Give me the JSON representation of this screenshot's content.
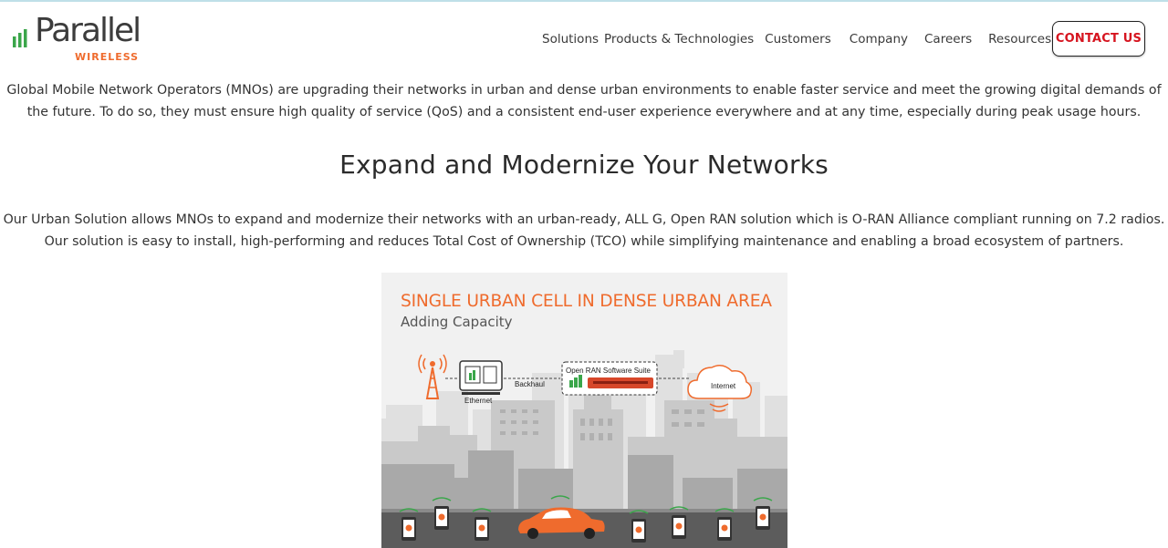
{
  "brand": {
    "name": "Parallel",
    "tagline": "WIRELESS",
    "accent_color": "#ef6b2d",
    "bars_color": "#3aa64a"
  },
  "nav": {
    "items": [
      {
        "label": "Solutions"
      },
      {
        "label": "Products & Technologies"
      },
      {
        "label": "Customers"
      },
      {
        "label": "Company"
      },
      {
        "label": "Careers"
      },
      {
        "label": "Resources"
      }
    ],
    "search_icon": "search-icon",
    "contact_label": "CONTACT US",
    "contact_color": "#d6141f"
  },
  "content": {
    "intro": "Global Mobile Network Operators (MNOs) are upgrading their networks in urban and dense urban environments to enable faster service and meet the growing digital demands of the future. To do so, they must ensure high quality of service (QoS) and a consistent end-user experience everywhere and at any time, especially during peak usage hours.",
    "heading": "Expand and Modernize Your Networks",
    "body": "Our Urban Solution allows MNOs to expand and modernize their networks with an urban-ready, ALL G, Open RAN solution which is O-RAN Alliance compliant running on 7.2 radios. Our solution is easy to install, high-performing and reduces Total Cost of Ownership (TCO) while simplifying maintenance and enabling a broad ecosystem of partners."
  },
  "infographic": {
    "title": "SINGLE URBAN CELL IN DENSE URBAN AREA",
    "subtitle": "Adding Capacity",
    "labels": {
      "ethernet": "Ethernet",
      "backhaul": "Backhaul",
      "suite": "Open RAN Software Suite",
      "internet": "Internet"
    },
    "icons": [
      "cell-tower-icon",
      "radio-unit-icon",
      "server-icon",
      "cloud-icon",
      "smartphone-icon",
      "car-icon"
    ]
  }
}
